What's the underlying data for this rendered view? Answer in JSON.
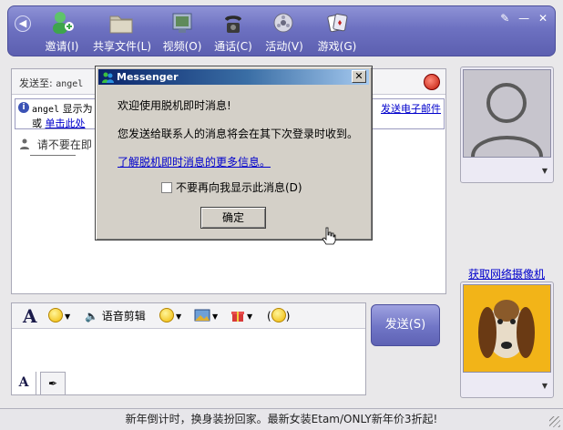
{
  "toolbar": {
    "items": [
      {
        "label": "邀请(I)",
        "icon": "invite-icon"
      },
      {
        "label": "共享文件(L)",
        "icon": "folder-icon"
      },
      {
        "label": "视频(O)",
        "icon": "video-icon"
      },
      {
        "label": "通话(C)",
        "icon": "phone-icon"
      },
      {
        "label": "活动(V)",
        "icon": "activities-icon"
      },
      {
        "label": "游戏(G)",
        "icon": "games-icon"
      }
    ],
    "minimize": "—",
    "close": "✕"
  },
  "conversation": {
    "to_label": "发送至:",
    "to_name": "angel",
    "info_name": "angel",
    "info_text": "显示为",
    "info_or": "或",
    "info_link": "单击此处",
    "info_right_link": "发送电子邮件",
    "warning": "请不要在即"
  },
  "compose": {
    "voice_clip": "语音剪辑",
    "send": "发送(S)"
  },
  "sidebar": {
    "webcam_link": "获取网络摄像机"
  },
  "ad_text": "新年倒计时，换身装扮回家。最新女装Etam/ONLY新年价3折起!",
  "dialog": {
    "title": "Messenger",
    "line1": "欢迎使用脱机即时消息!",
    "line2": "您发送给联系人的消息将会在其下次登录时收到。",
    "link": "了解脱机即时消息的更多信息。",
    "checkbox": "不要再向我显示此消息(D)",
    "ok": "确定",
    "close": "✕"
  }
}
